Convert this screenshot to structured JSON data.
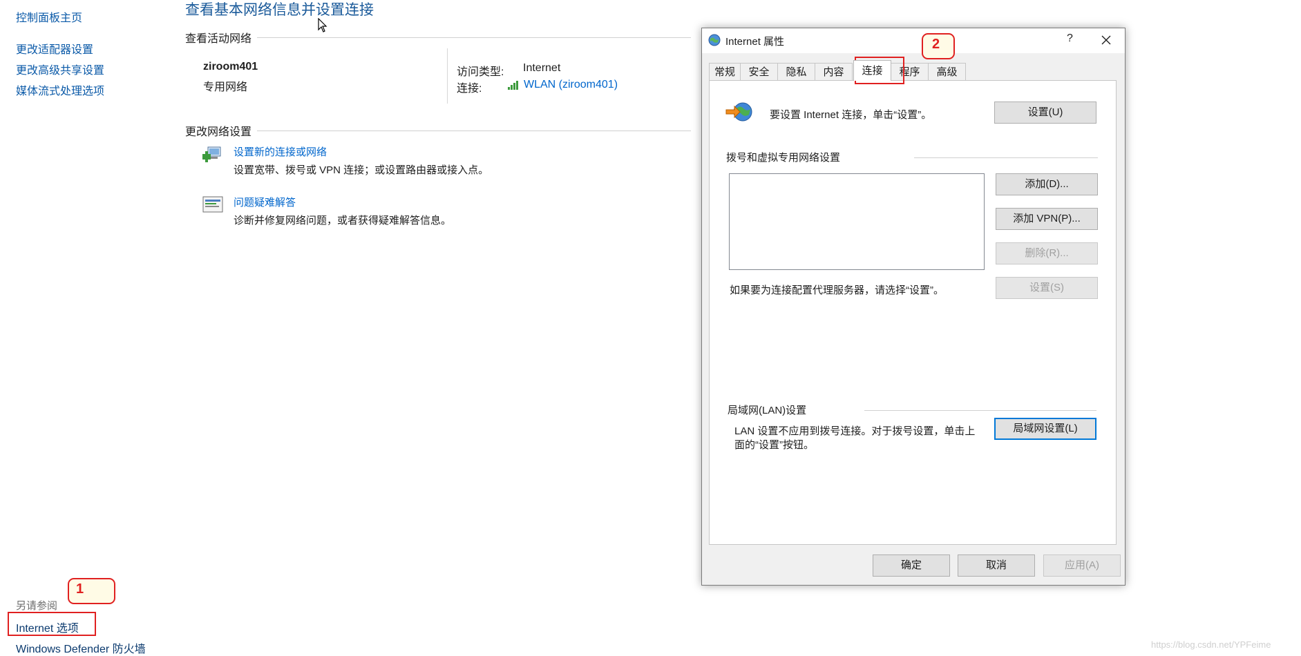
{
  "sidebar": {
    "home": "控制面板主页",
    "items": [
      "更改适配器设置",
      "更改高级共享设置",
      "媒体流式处理选项"
    ],
    "see_also": "另请参阅",
    "links": [
      "Internet 选项",
      "Windows Defender 防火墙"
    ]
  },
  "main": {
    "title": "查看基本网络信息并设置连接",
    "active_networks_header": "查看活动网络",
    "network": {
      "name": "ziroom401",
      "type": "专用网络",
      "access_type_label": "访问类型:",
      "access_type_value": "Internet",
      "connection_label": "连接:",
      "connection_value": "WLAN (ziroom401)"
    },
    "change_settings_header": "更改网络设置",
    "tasks": [
      {
        "title": "设置新的连接或网络",
        "desc": "设置宽带、拨号或 VPN 连接；或设置路由器或接入点。"
      },
      {
        "title": "问题疑难解答",
        "desc": "诊断并修复网络问题，或者获得疑难解答信息。"
      }
    ]
  },
  "dialog": {
    "title": "Internet 属性",
    "help_button": "?",
    "tabs": [
      "常规",
      "安全",
      "隐私",
      "内容",
      "连接",
      "程序",
      "高级"
    ],
    "active_tab": "连接",
    "setup_text": "要设置 Internet 连接，单击“设置”。",
    "setup_button": "设置(U)",
    "dialup_header": "拨号和虚拟专用网络设置",
    "add_button": "添加(D)...",
    "add_vpn_button": "添加 VPN(P)...",
    "remove_button": "删除(R)...",
    "proxy_text": "如果要为连接配置代理服务器，请选择“设置”。",
    "settings_button": "设置(S)",
    "lan_header": "局域网(LAN)设置",
    "lan_text_line1": "LAN 设置不应用到拨号连接。对于拨号设置，单击上",
    "lan_text_line2": "面的“设置”按钮。",
    "lan_button": "局域网设置(L)",
    "ok_button": "确定",
    "cancel_button": "取消",
    "apply_button": "应用(A)"
  },
  "annotations": {
    "callout1": "1",
    "callout2": "2"
  },
  "watermark": "https://blog.csdn.net/YPFeime",
  "colors": {
    "link": "#0066cc",
    "annotation_red": "#e02020",
    "dialog_bg": "#f0f0f0"
  }
}
